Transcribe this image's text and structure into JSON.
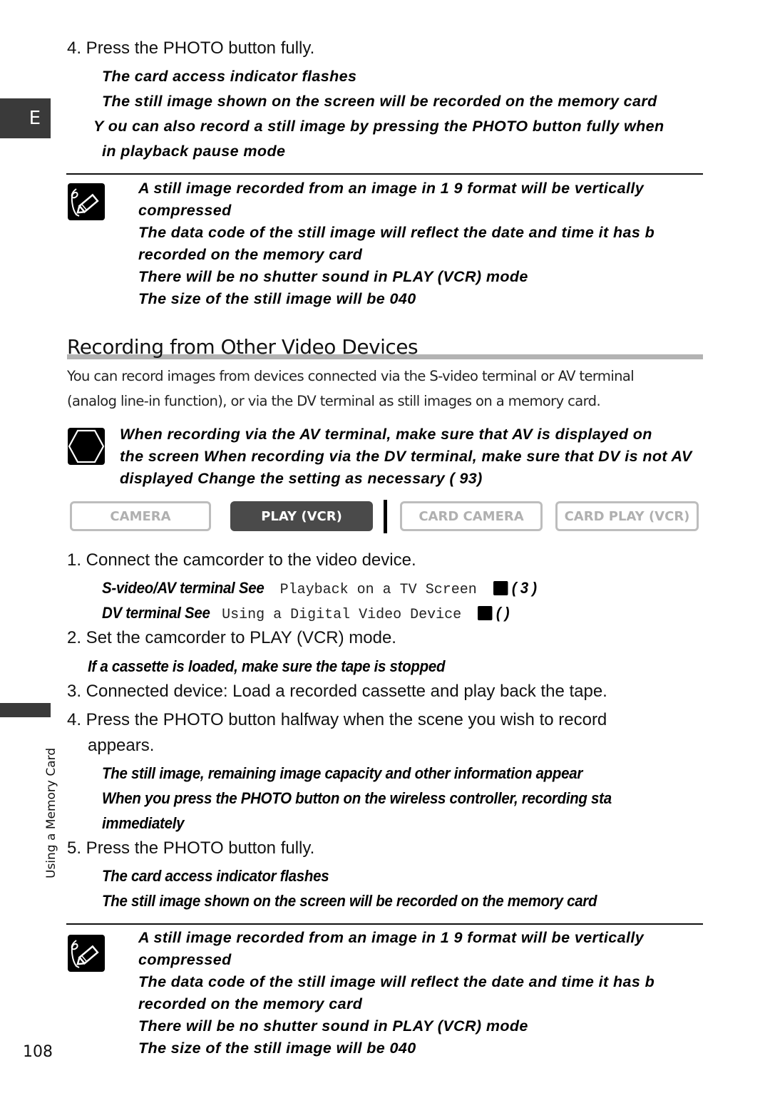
{
  "page": {
    "language_tab": "E",
    "side_label": "Using a Memory Card",
    "page_number": "108"
  },
  "top_section": {
    "step4": "4. Press the PHOTO button fully.",
    "step4_notes": [
      "The card access indicator flashes",
      "The still image shown on the screen will be recorded on the memory card",
      "Y ou can also record a still image by pressing the PHOTO button fully when",
      "in playback pause mode"
    ],
    "notes_icon": "pencil-note-icon",
    "notes": [
      "A still image recorded from an image in 1   9 format will be vertically",
      "compressed",
      "The data code of the still image will reflect the date and time it has b",
      "recorded on the memory card",
      "There will be no shutter sound in PLAY (VCR) mode",
      "The size of the still image will be 040"
    ]
  },
  "section": {
    "title": "Recording from Other Video Devices",
    "intro": [
      "You can record images from devices connected via the S-video terminal or AV terminal",
      "(analog line-in function), or via the DV terminal as still images on a memory card."
    ],
    "caution_icon": "caution-hexagon-icon",
    "caution": [
      "When recording via the AV terminal, make sure that AV is displayed on",
      "the screen  When recording via the DV terminal, make sure that DV is not AV",
      "displayed  Change the setting as necessary (     93)"
    ],
    "modes": [
      {
        "label": "CAMERA",
        "active": false
      },
      {
        "label": "PLAY (VCR)",
        "active": true
      },
      {
        "label": "CARD CAMERA",
        "active": false
      },
      {
        "label": "CARD PLAY (VCR)",
        "active": false
      }
    ],
    "steps": {
      "s1": "1. Connect the camcorder to the video device.",
      "s1_a_bold": "S-video/AV terminal  See",
      "s1_a_text": "Playback on a TV Screen",
      "s1_a_ref": "( 3 )",
      "s1_b_bold": "DV terminal  See",
      "s1_b_text": "Using a Digital Video Device",
      "s1_b_ref": "(    )",
      "s2": "2. Set the camcorder to PLAY (VCR) mode.",
      "s2_note": "If a cassette is loaded, make sure the tape is stopped",
      "s3": "3. Connected device: Load a recorded cassette and play back the tape.",
      "s4_line1": "4. Press the PHOTO button halfway when the scene you wish to record",
      "s4_line2": "appears.",
      "s4_notes": [
        "The still image, remaining image capacity and other information appear",
        "When you press the PHOTO button on the wireless controller, recording sta",
        "immediately"
      ],
      "s5": "5. Press the PHOTO button fully.",
      "s5_notes": [
        "The card access indicator flashes",
        "The still image shown on the screen will be recorded on the memory card"
      ]
    },
    "notes_icon": "pencil-note-icon",
    "notes": [
      "A still image recorded from an image in 1   9 format will be vertically",
      "compressed",
      "The data code of the still image will reflect the date and time it has b",
      "recorded on the memory card",
      "There will be no shutter sound in PLAY (VCR) mode",
      "The size of the still image will be 040"
    ]
  }
}
